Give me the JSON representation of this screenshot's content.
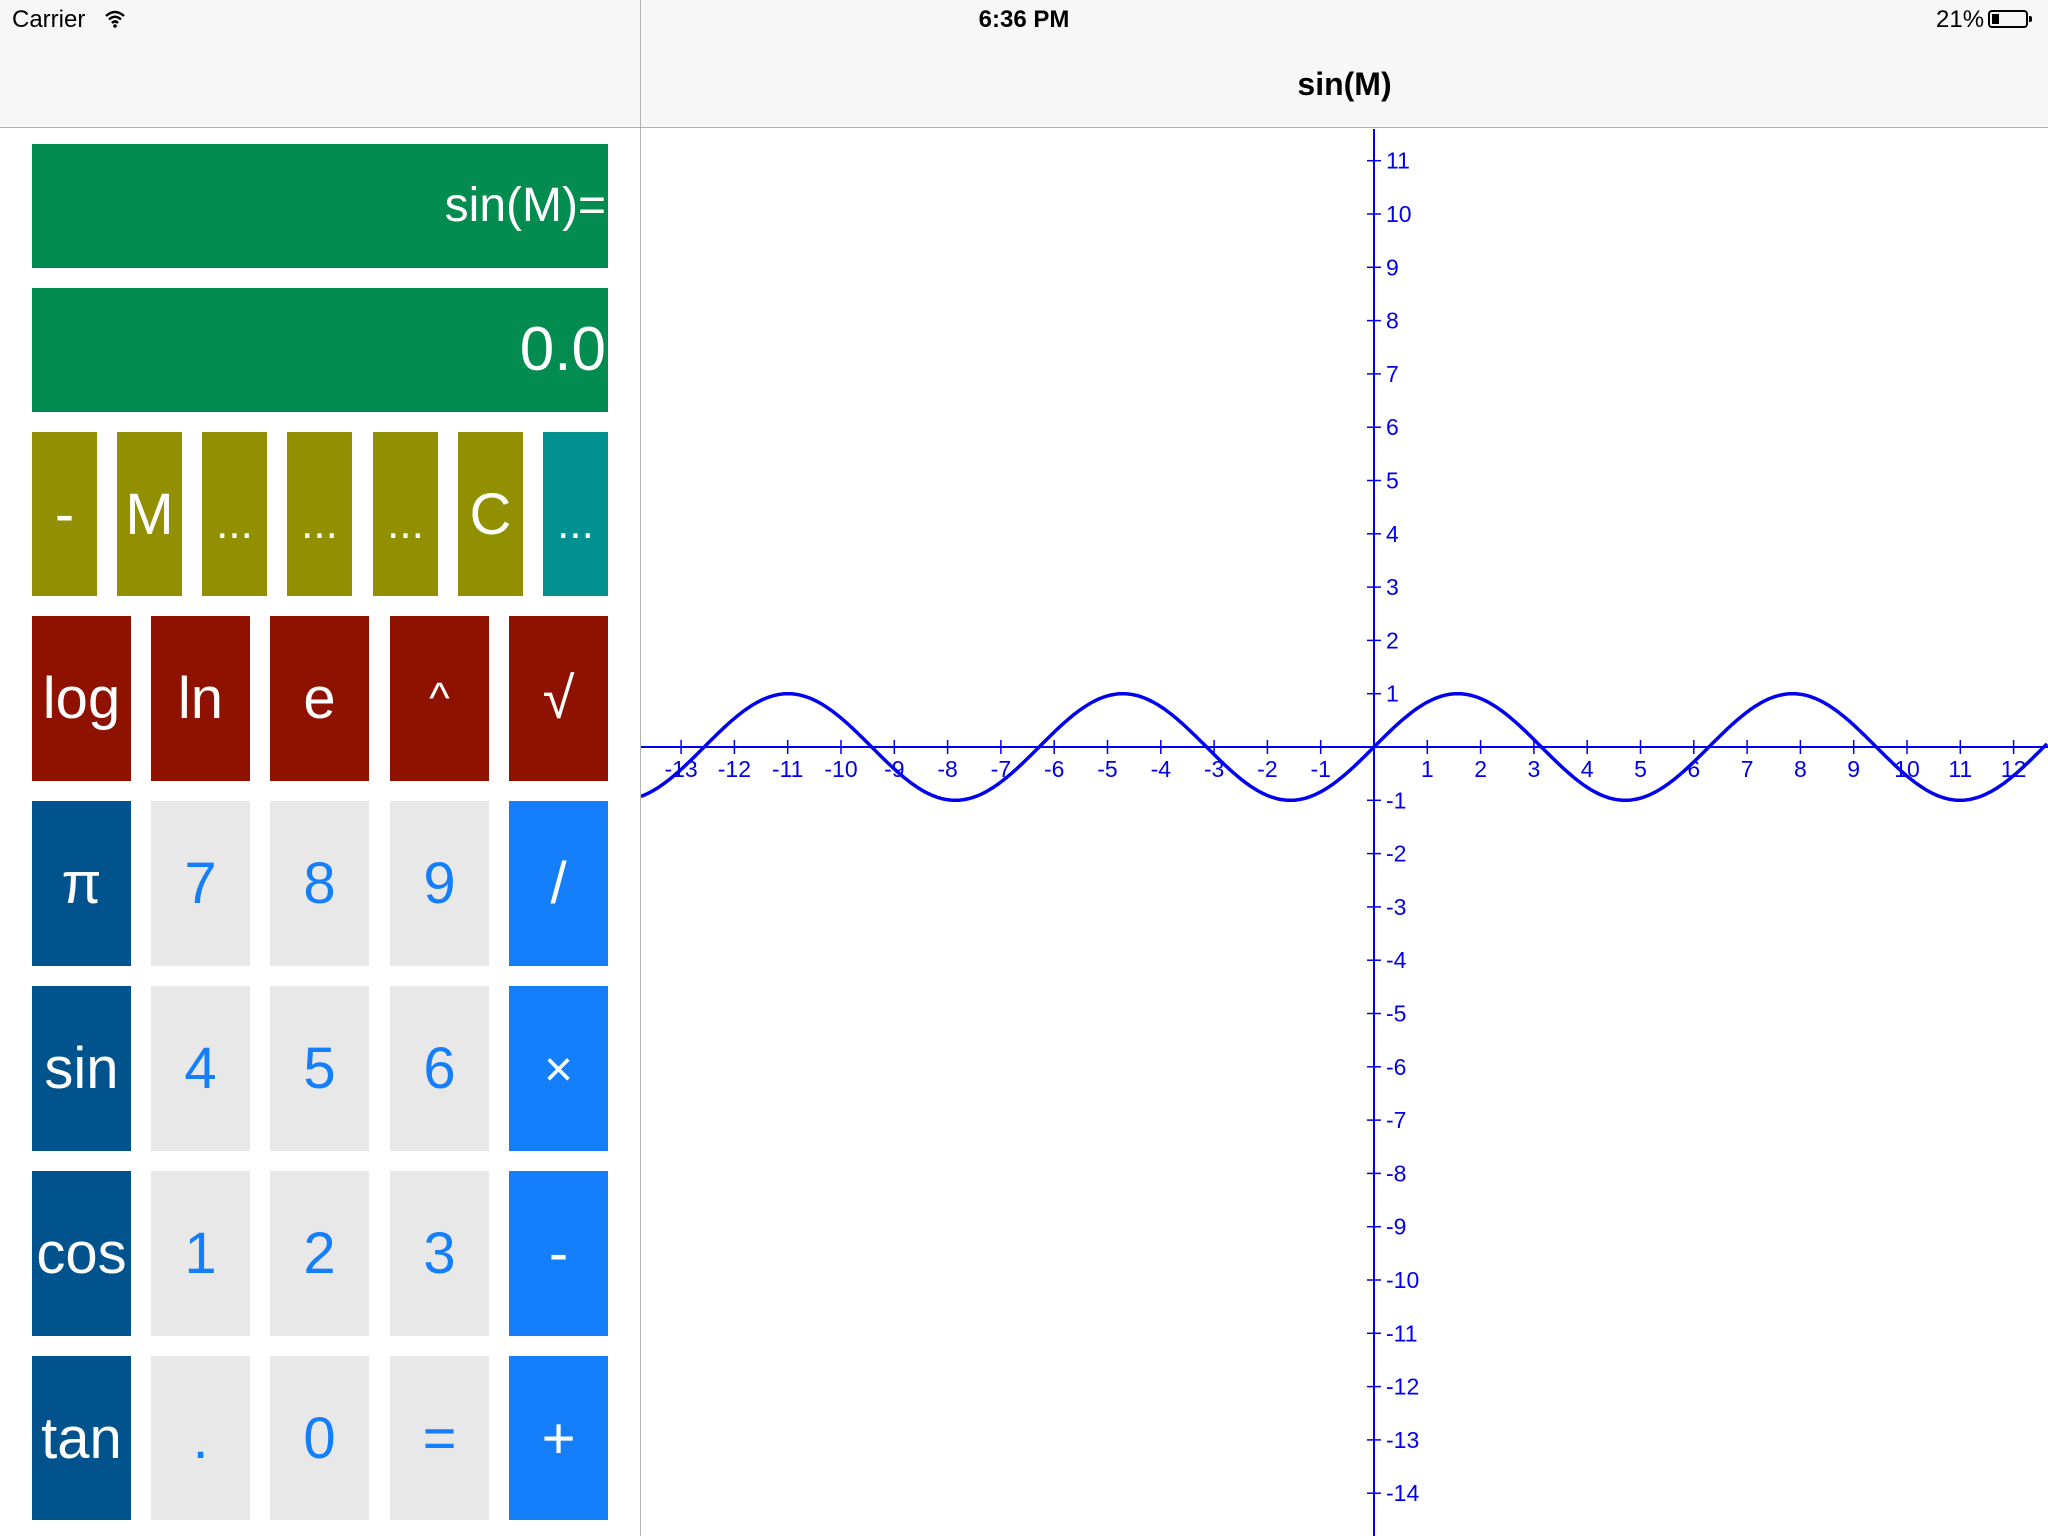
{
  "status_bar": {
    "carrier": "Carrier",
    "time": "6:36 PM",
    "battery": "21%"
  },
  "nav": {
    "graph_title": "sin(M)"
  },
  "display": {
    "expression": "sin(M)=",
    "result": "0.0"
  },
  "memory_row": [
    "-",
    "M",
    "...",
    "...",
    "...",
    "C",
    "..."
  ],
  "keypad": {
    "row1": [
      "log",
      "ln",
      "e",
      "^",
      "√"
    ],
    "row2": [
      "π",
      "7",
      "8",
      "9",
      "/"
    ],
    "row3": [
      "sin",
      "4",
      "5",
      "6",
      "×"
    ],
    "row4": [
      "cos",
      "1",
      "2",
      "3",
      "-"
    ],
    "row5": [
      "tan",
      ".",
      "0",
      "=",
      "+"
    ]
  },
  "colors": {
    "display": "#028c4f",
    "memory_key": "#928f00",
    "memory_more_key": "#019191",
    "function_key": "#8f1200",
    "trig_key": "#00538d",
    "digit_key": "#e8e8e8",
    "operator_key": "#147efb",
    "graph": "#0000ee"
  },
  "chart_data": {
    "type": "line",
    "function": "sin(M)",
    "xlim": [
      -13.7,
      12.3
    ],
    "ylim": [
      -14.8,
      11.6
    ],
    "x_ticks": [
      -13,
      -12,
      -11,
      -10,
      -9,
      -8,
      -7,
      -6,
      -5,
      -4,
      -3,
      -2,
      -1,
      1,
      2,
      3,
      4,
      5,
      6,
      7,
      8,
      9,
      10,
      11,
      12
    ],
    "y_ticks": [
      11,
      10,
      9,
      8,
      7,
      6,
      5,
      4,
      3,
      2,
      1,
      -1,
      -2,
      -3,
      -4,
      -5,
      -6,
      -7,
      -8,
      -9,
      -10,
      -11,
      -12,
      -13,
      -14
    ],
    "series": [
      {
        "values": "sin(x)"
      }
    ],
    "grid": false
  }
}
